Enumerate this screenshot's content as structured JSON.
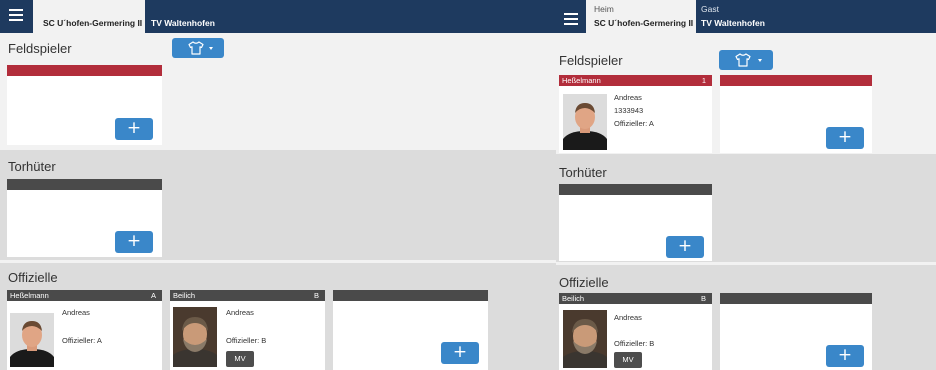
{
  "left": {
    "tabs": [
      {
        "team": "SC U´hofen-Germering II"
      },
      {
        "team": "TV Waltenhofen"
      }
    ],
    "feldspieler": {
      "title": "Feldspieler"
    },
    "torhueter": {
      "title": "Torhüter"
    },
    "offizielle": {
      "title": "Offizielle",
      "cards": [
        {
          "header_name": "Heßelmann",
          "header_code": "A",
          "first_name": "Andreas",
          "role": "Offizieller: A"
        },
        {
          "header_name": "Beilich",
          "header_code": "B",
          "first_name": "Andreas",
          "role": "Offizieller: B",
          "badge": "MV"
        }
      ]
    }
  },
  "right": {
    "tabs": [
      {
        "sub": "Heim",
        "team": "SC U´hofen-Germering II"
      },
      {
        "sub": "Gast",
        "team": "TV Waltenhofen"
      }
    ],
    "feldspieler": {
      "title": "Feldspieler",
      "cards": [
        {
          "header_name": "Heßelmann",
          "header_code": "1",
          "first_name": "Andreas",
          "number": "1333943",
          "role": "Offizieller: A"
        }
      ]
    },
    "torhueter": {
      "title": "Torhüter"
    },
    "offizielle": {
      "title": "Offizielle",
      "cards": [
        {
          "header_name": "Beilich",
          "header_code": "B",
          "first_name": "Andreas",
          "role": "Offizieller: B",
          "badge": "MV"
        }
      ]
    }
  },
  "icons": {
    "menu": "hamburger-menu-icon",
    "jersey": "jersey-icon",
    "add": "plus-icon",
    "dropdown": "caret-down-icon"
  },
  "add_symbol": "+",
  "colors": {
    "topbar": "#1e3a5f",
    "accent": "#3a87c9",
    "player_header": "#b22d3b",
    "official_header": "#4a4a4a"
  }
}
